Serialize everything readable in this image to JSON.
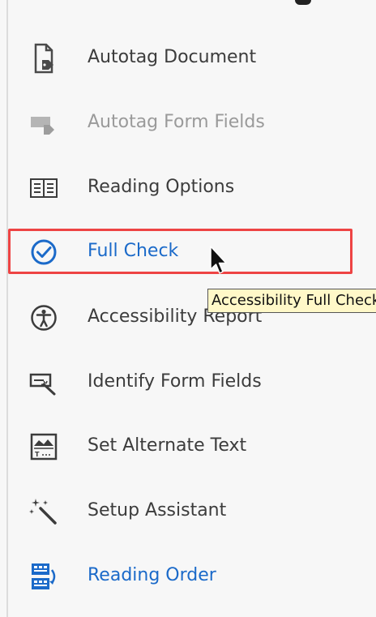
{
  "tools": [
    {
      "id": "autotag-document",
      "label": "Autotag Document",
      "icon": "document-tag-icon",
      "state": "enabled"
    },
    {
      "id": "autotag-form-fields",
      "label": "Autotag Form Fields",
      "icon": "form-tag-icon",
      "state": "disabled"
    },
    {
      "id": "reading-options",
      "label": "Reading Options",
      "icon": "book-icon",
      "state": "enabled"
    },
    {
      "id": "full-check",
      "label": "Full Check",
      "icon": "check-circle-icon",
      "state": "active"
    },
    {
      "id": "accessibility-report",
      "label": "Accessibility Report",
      "icon": "accessibility-icon",
      "state": "enabled"
    },
    {
      "id": "identify-form-fields",
      "label": "Identify Form Fields",
      "icon": "form-wand-icon",
      "state": "enabled"
    },
    {
      "id": "set-alternate-text",
      "label": "Set Alternate Text",
      "icon": "image-text-icon",
      "state": "enabled"
    },
    {
      "id": "setup-assistant",
      "label": "Setup Assistant",
      "icon": "magic-wand-icon",
      "state": "enabled"
    },
    {
      "id": "reading-order",
      "label": "Reading Order",
      "icon": "reading-order-icon",
      "state": "blue"
    }
  ],
  "tooltip": {
    "text": "Accessibility Full Check"
  },
  "colors": {
    "highlight": "#ee4444",
    "accent": "#1b6ac9",
    "text": "#3c3c3c",
    "disabled": "#9a9a9a",
    "tooltip_bg": "#fff8c8"
  }
}
